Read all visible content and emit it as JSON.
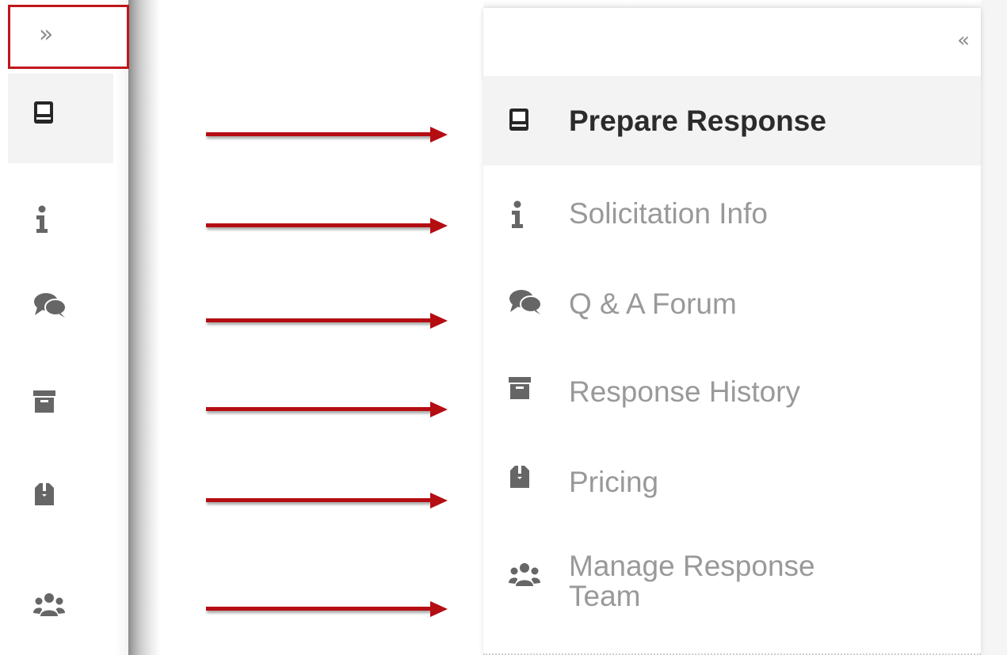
{
  "collapsed_sidebar": {
    "toggle_label": "»"
  },
  "expanded_sidebar": {
    "toggle_label": "«",
    "items": [
      {
        "label": "Prepare Response",
        "icon": "book-icon",
        "active": true
      },
      {
        "label": "Solicitation Info",
        "icon": "info-icon",
        "active": false
      },
      {
        "label": "Q & A Forum",
        "icon": "comments-icon",
        "active": false
      },
      {
        "label": "Response History",
        "icon": "archive-icon",
        "active": false
      },
      {
        "label": "Pricing",
        "icon": "box-icon",
        "active": false
      },
      {
        "label": "Manage Response Team",
        "icon": "users-icon",
        "active": false
      }
    ]
  },
  "colors": {
    "annotation_red": "#b40d12",
    "active_bg": "#f3f3f3",
    "active_text": "#2b2b2b",
    "inactive_text": "#999999"
  }
}
